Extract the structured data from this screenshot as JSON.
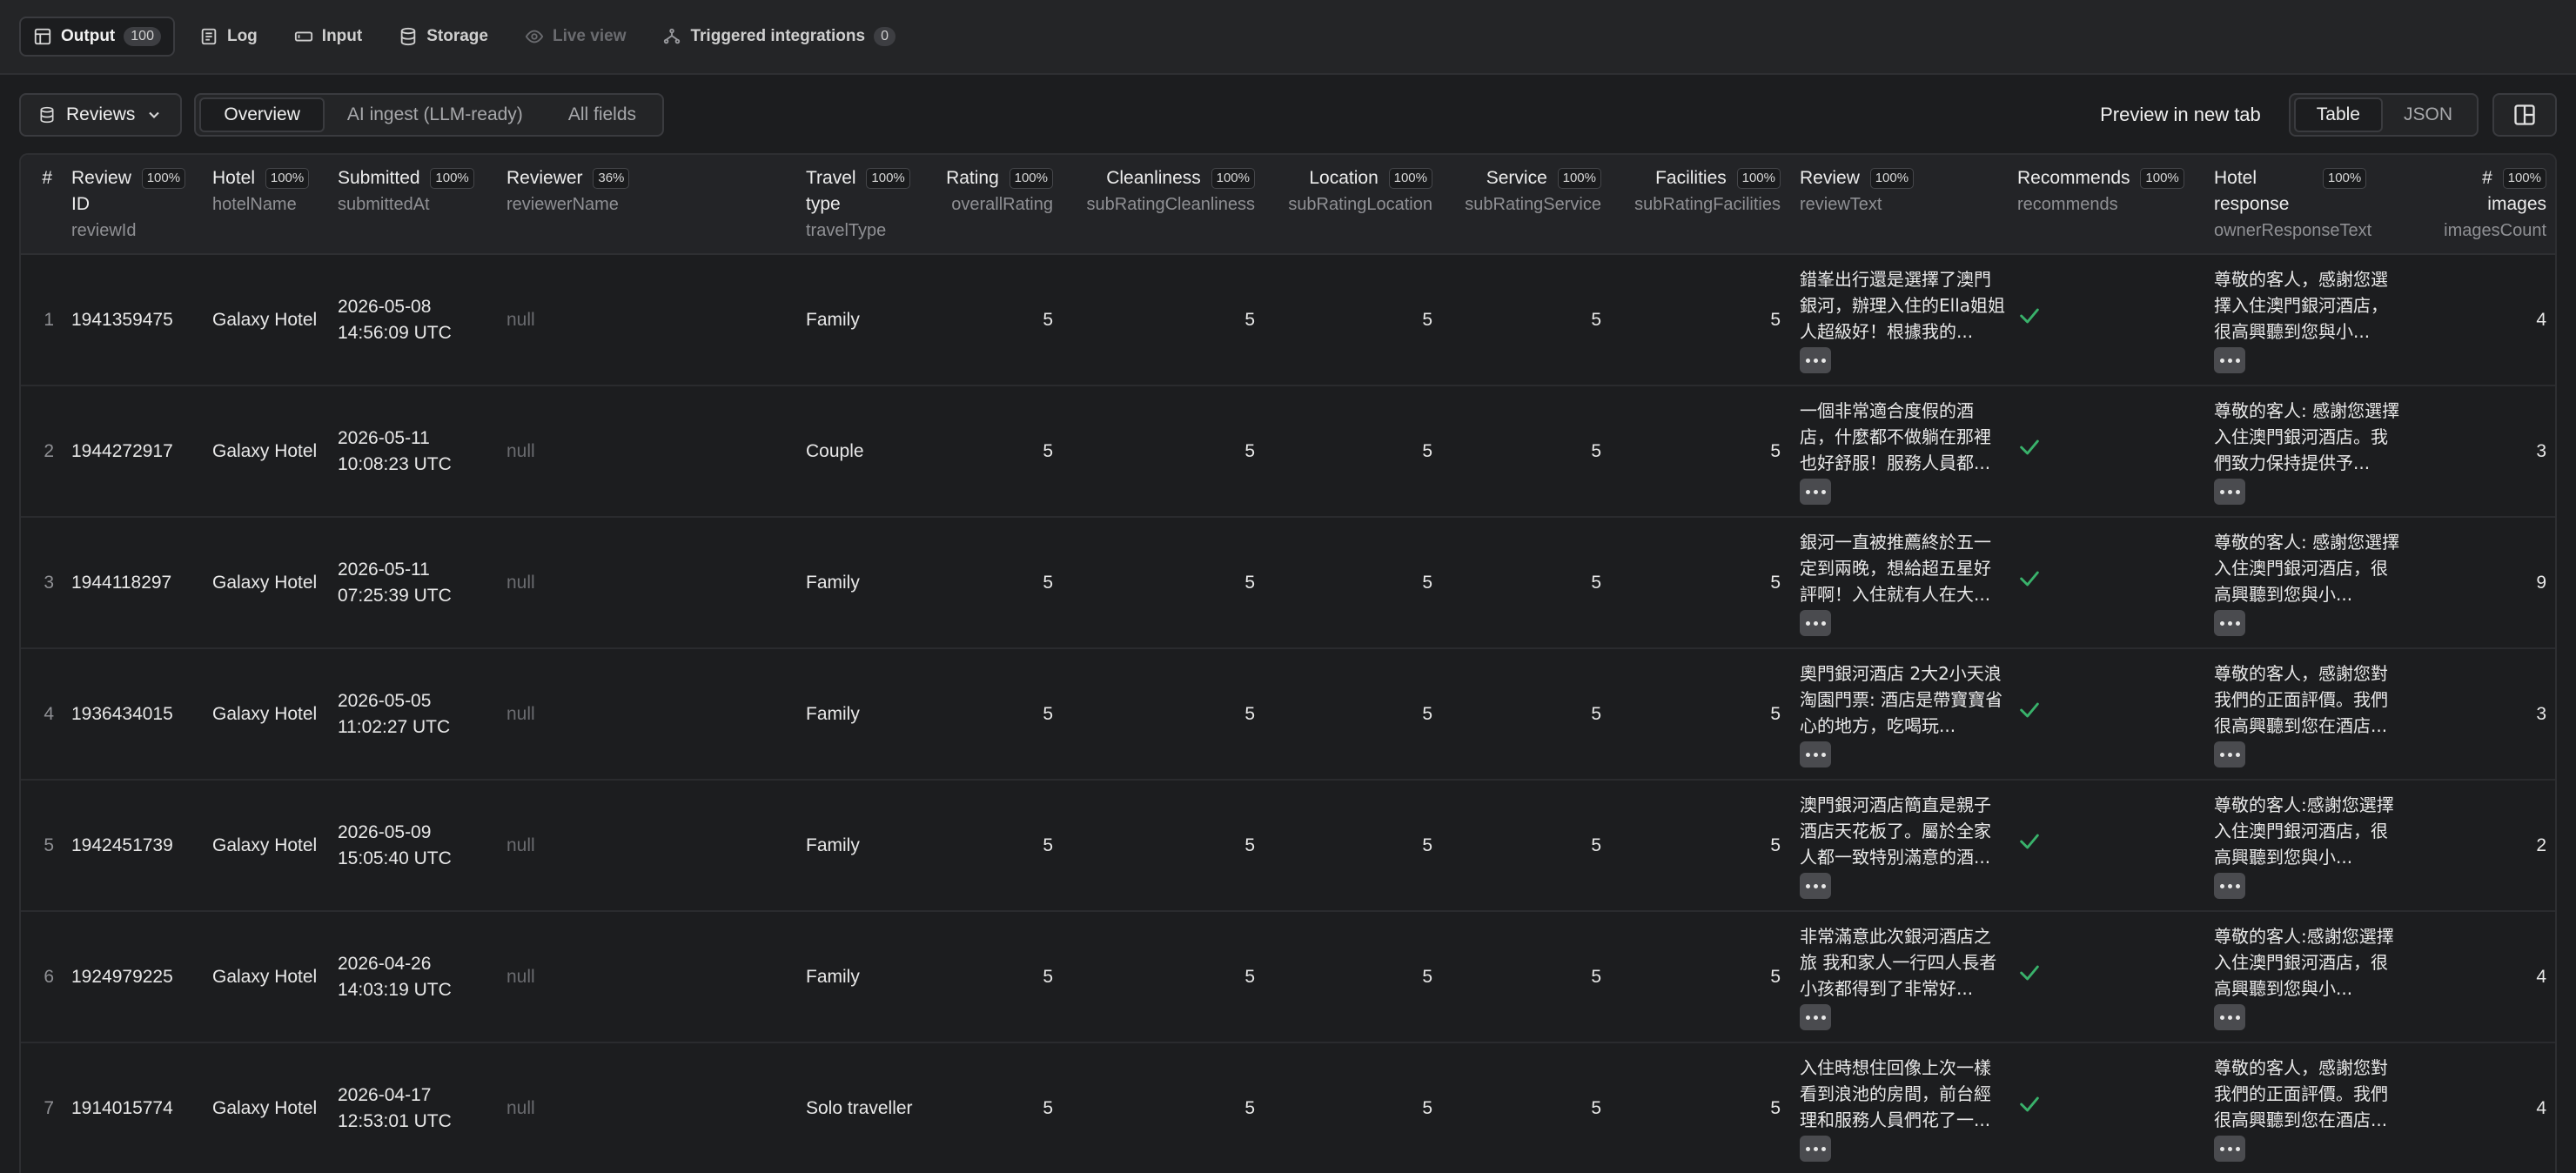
{
  "tabs": [
    {
      "label": "Output",
      "count": "100",
      "icon": "table-icon"
    },
    {
      "label": "Log",
      "icon": "log-icon"
    },
    {
      "label": "Input",
      "icon": "input-icon"
    },
    {
      "label": "Storage",
      "icon": "storage-icon"
    },
    {
      "label": "Live view",
      "icon": "eye-icon"
    },
    {
      "label": "Triggered integrations",
      "count": "0",
      "icon": "integrations-icon"
    }
  ],
  "toolbar": {
    "dataset_label": "Reviews",
    "views": [
      "Overview",
      "AI ingest (LLM-ready)",
      "All fields"
    ],
    "preview_label": "Preview in new tab",
    "formats": [
      "Table",
      "JSON"
    ]
  },
  "columns": [
    {
      "title": "#",
      "key": "",
      "pct": ""
    },
    {
      "title": "Review ID",
      "key": "reviewId",
      "pct": "100%"
    },
    {
      "title": "Hotel",
      "key": "hotelName",
      "pct": "100%"
    },
    {
      "title": "Submitted",
      "key": "submittedAt",
      "pct": "100%"
    },
    {
      "title": "Reviewer",
      "key": "reviewerName",
      "pct": "36%"
    },
    {
      "title": "Travel type",
      "key": "travelType",
      "pct": "100%"
    },
    {
      "title": "Rating",
      "key": "overallRating",
      "pct": "100%"
    },
    {
      "title": "Cleanliness",
      "key": "subRatingCleanliness",
      "pct": "100%"
    },
    {
      "title": "Location",
      "key": "subRatingLocation",
      "pct": "100%"
    },
    {
      "title": "Service",
      "key": "subRatingService",
      "pct": "100%"
    },
    {
      "title": "Facilities",
      "key": "subRatingFacilities",
      "pct": "100%"
    },
    {
      "title": "Review",
      "key": "reviewText",
      "pct": "100%"
    },
    {
      "title": "Recommends",
      "key": "recommends",
      "pct": "100%"
    },
    {
      "title": "Hotel response",
      "key": "ownerResponseText",
      "pct": "100%"
    },
    {
      "title": "# images",
      "key": "imagesCount",
      "pct": "100%"
    }
  ],
  "rows": [
    {
      "n": "1",
      "id": "1941359475",
      "hotel": "Galaxy Hotel",
      "date": "2026-05-08",
      "time": "14:56:09 UTC",
      "reviewer": "null",
      "travel": "Family",
      "rating": "5",
      "clean": "5",
      "loc": "5",
      "serv": "5",
      "fac": "5",
      "review": "錯峯出行還是選擇了澳門銀河，辦理入住的Ella姐姐人超級好！根據我的...",
      "response": "尊敬的客人，感謝您選擇入住澳門銀河酒店，很高興聽到您與小...",
      "images": "4"
    },
    {
      "n": "2",
      "id": "1944272917",
      "hotel": "Galaxy Hotel",
      "date": "2026-05-11",
      "time": "10:08:23 UTC",
      "reviewer": "null",
      "travel": "Couple",
      "rating": "5",
      "clean": "5",
      "loc": "5",
      "serv": "5",
      "fac": "5",
      "review": "一個非常適合度假的酒店，什麼都不做躺在那裡也好舒服！服務人員都...",
      "response": "尊敬的客人: 感謝您選擇入住澳門銀河酒店。我們致力保持提供予...",
      "images": "3"
    },
    {
      "n": "3",
      "id": "1944118297",
      "hotel": "Galaxy Hotel",
      "date": "2026-05-11",
      "time": "07:25:39 UTC",
      "reviewer": "null",
      "travel": "Family",
      "rating": "5",
      "clean": "5",
      "loc": "5",
      "serv": "5",
      "fac": "5",
      "review": "銀河一直被推薦終於五一定到兩晚，想給超五星好評啊！入住就有人在大...",
      "response": "尊敬的客人: 感謝您選擇入住澳門銀河酒店，很高興聽到您與小...",
      "images": "9"
    },
    {
      "n": "4",
      "id": "1936434015",
      "hotel": "Galaxy Hotel",
      "date": "2026-05-05",
      "time": "11:02:27 UTC",
      "reviewer": "null",
      "travel": "Family",
      "rating": "5",
      "clean": "5",
      "loc": "5",
      "serv": "5",
      "fac": "5",
      "review": "奧門銀河酒店 2大2小天浪淘園門票: 酒店是帶寶寶省心的地方，吃喝玩...",
      "response": "尊敬的客人，感謝您對我們的正面評價。我們很高興聽到您在酒店...",
      "images": "3"
    },
    {
      "n": "5",
      "id": "1942451739",
      "hotel": "Galaxy Hotel",
      "date": "2026-05-09",
      "time": "15:05:40 UTC",
      "reviewer": "null",
      "travel": "Family",
      "rating": "5",
      "clean": "5",
      "loc": "5",
      "serv": "5",
      "fac": "5",
      "review": "澳門銀河酒店簡直是親子酒店天花板了。屬於全家人都一致特別滿意的酒...",
      "response": "尊敬的客人:感謝您選擇入住澳門銀河酒店，很高興聽到您與小...",
      "images": "2"
    },
    {
      "n": "6",
      "id": "1924979225",
      "hotel": "Galaxy Hotel",
      "date": "2026-04-26",
      "time": "14:03:19 UTC",
      "reviewer": "null",
      "travel": "Family",
      "rating": "5",
      "clean": "5",
      "loc": "5",
      "serv": "5",
      "fac": "5",
      "review": "非常滿意此次銀河酒店之旅 我和家人一行四人長者小孩都得到了非常好...",
      "response": "尊敬的客人:感謝您選擇入住澳門銀河酒店，很高興聽到您與小...",
      "images": "4"
    },
    {
      "n": "7",
      "id": "1914015774",
      "hotel": "Galaxy Hotel",
      "date": "2026-04-17",
      "time": "12:53:01 UTC",
      "reviewer": "null",
      "travel": "Solo traveller",
      "rating": "5",
      "clean": "5",
      "loc": "5",
      "serv": "5",
      "fac": "5",
      "review": "入住時想住回像上次一樣看到浪池的房間，前台經理和服務人員們花了一...",
      "response": "尊敬的客人，感謝您對我們的正面評價。我們很高興聽到您在酒店...",
      "images": "4"
    }
  ],
  "colors": {
    "accent_check": "#39b26b",
    "background": "#1c1d1f",
    "header_bg": "#232427"
  }
}
